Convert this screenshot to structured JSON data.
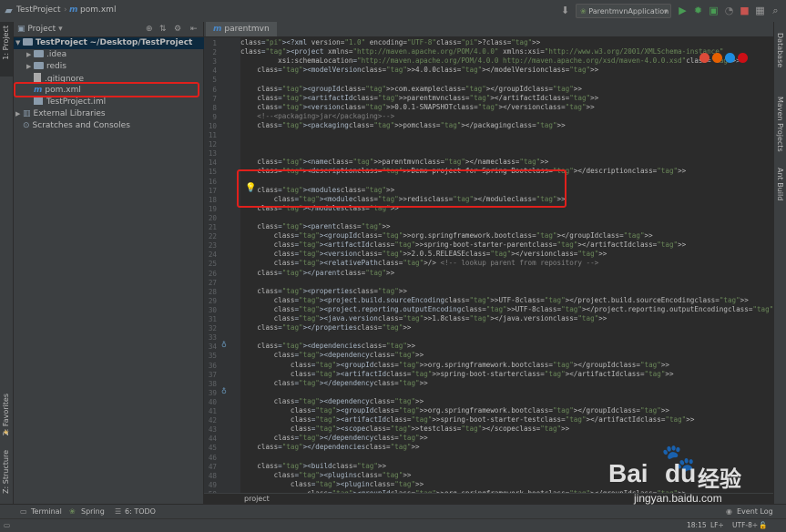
{
  "navbar": {
    "project_crumb": "TestProject",
    "file_crumb": "pom.xml",
    "run_config": "ParentmvnApplication"
  },
  "left_strip": {
    "project_tab": "1: Project",
    "favorites_tab": "2: Favorites",
    "structure_tab": "Z: Structure"
  },
  "right_strip": {
    "database_tab": "Database",
    "maven_tab": "Maven Projects",
    "ant_tab": "Ant Build"
  },
  "project_panel": {
    "header": "Project",
    "tree": [
      {
        "label": "TestProject",
        "suffix": "~/Desktop/TestProject",
        "type": "module"
      },
      {
        "label": ".idea",
        "type": "folder"
      },
      {
        "label": "redis",
        "type": "folder"
      },
      {
        "label": ".gitignore",
        "type": "file"
      },
      {
        "label": "pom.xml",
        "type": "maven"
      },
      {
        "label": "TestProject.iml",
        "type": "file"
      },
      {
        "label": "External Libraries",
        "type": "lib"
      },
      {
        "label": "Scratches and Consoles",
        "type": "scratch"
      }
    ]
  },
  "editor": {
    "tab": "parentmvn",
    "breadcrumb": "project",
    "lines": [
      "<?xml version=\"1.0\" encoding=\"UTF-8\"?>",
      "<project xmlns=\"http://maven.apache.org/POM/4.0.0\" xmlns:xsi=\"http://www.w3.org/2001/XMLSchema-instance\"",
      "         xsi:schemaLocation=\"http://maven.apache.org/POM/4.0.0 http://maven.apache.org/xsd/maven-4.0.0.xsd\">",
      "    <modelVersion>4.0.0</modelVersion>",
      "",
      "    <groupId>com.example</groupId>",
      "    <artifactId>parentmvn</artifactId>",
      "    <version>0.0.1-SNAPSHOT</version>",
      "    <!--<packaging>jar</packaging>-->",
      "    <packaging>pom</packaging>",
      "",
      "",
      "",
      "    <name>parentmvn</name>",
      "    <description>Demo project for Spring Boot</description>",
      "",
      "    <modules>",
      "        <module>redis</module>",
      "    </modules>",
      "",
      "    <parent>",
      "        <groupId>org.springframework.boot</groupId>",
      "        <artifactId>spring-boot-starter-parent</artifactId>",
      "        <version>2.0.5.RELEASE</version>",
      "        <relativePath/> <!-- lookup parent from repository -->",
      "    </parent>",
      "",
      "    <properties>",
      "        <project.build.sourceEncoding>UTF-8</project.build.sourceEncoding>",
      "        <project.reporting.outputEncoding>UTF-8</project.reporting.outputEncoding>",
      "        <java.version>1.8</java.version>",
      "    </properties>",
      "",
      "    <dependencies>",
      "        <dependency>",
      "            <groupId>org.springframework.boot</groupId>",
      "            <artifactId>spring-boot-starter</artifactId>",
      "        </dependency>",
      "",
      "        <dependency>",
      "            <groupId>org.springframework.boot</groupId>",
      "            <artifactId>spring-boot-starter-test</artifactId>",
      "            <scope>test</scope>",
      "        </dependency>",
      "    </dependencies>",
      "",
      "    <build>",
      "        <plugins>",
      "            <plugin>",
      "                <groupId>org.springframework.boot</groupId>"
    ]
  },
  "bottom_tools": {
    "terminal": "Terminal",
    "spring": "Spring",
    "todo": "6: TODO",
    "event_log": "Event Log"
  },
  "status": {
    "position": "18:15",
    "line_sep": "LF÷",
    "encoding": "UTF-8÷"
  },
  "watermark": {
    "brand": "Bai",
    "brand2": "du",
    "service": "经验",
    "url": "jingyan.baidu.com"
  },
  "colors": {
    "highlight": "#e0201c",
    "selection": "#0d293e",
    "run_green": "#499c54"
  }
}
